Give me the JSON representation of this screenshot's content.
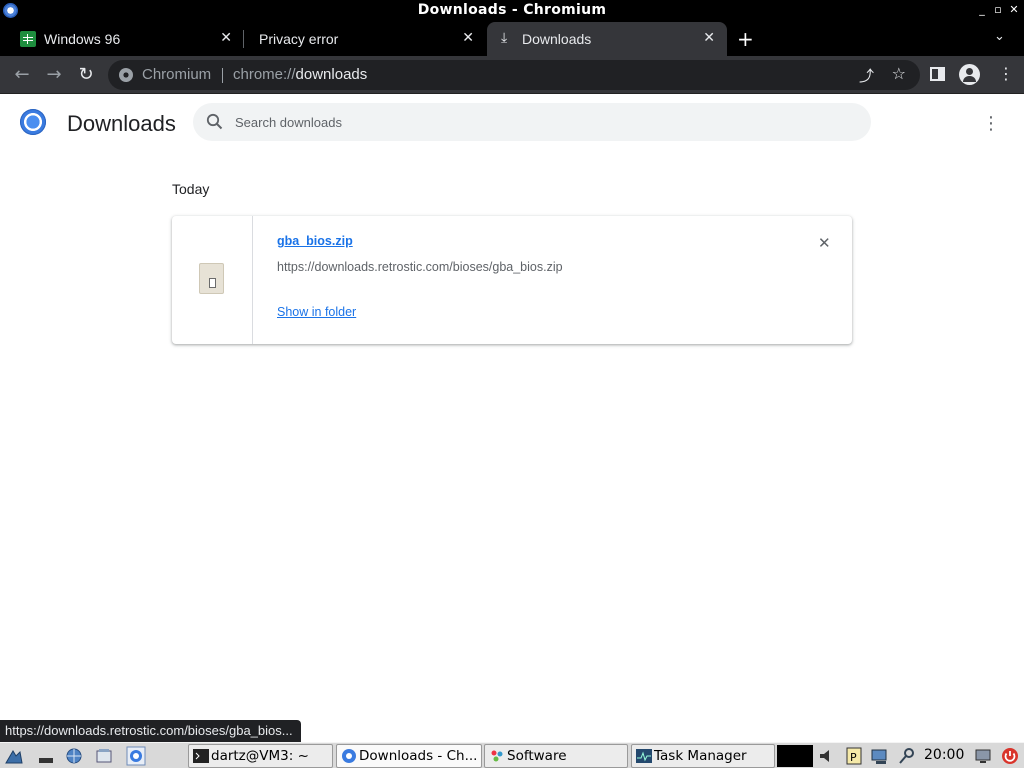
{
  "window": {
    "title": "Downloads - Chromium",
    "minimize_glyph": "_",
    "maximize_glyph": "▫",
    "close_glyph": "✕"
  },
  "tabs": [
    {
      "title": "Windows 96",
      "active": false,
      "favicon": "spreadsheet-icon"
    },
    {
      "title": "Privacy error",
      "active": false,
      "favicon": "none"
    },
    {
      "title": "Downloads",
      "active": true,
      "favicon": "download-icon"
    }
  ],
  "tab_close_glyph": "✕",
  "new_tab_glyph": "+",
  "toolbar": {
    "back_glyph": "←",
    "forward_glyph": "→",
    "reload_glyph": "↻",
    "origin_label": "Chromium",
    "url_scheme": "chrome://",
    "url_host": "downloads",
    "share_glyph": "⤴",
    "star_glyph": "☆",
    "menu_glyph": "⋮"
  },
  "page": {
    "title": "Downloads",
    "search_placeholder": "Search downloads",
    "more_glyph": "⋮",
    "section_label": "Today",
    "downloads": [
      {
        "file_name": "gba_bios.zip",
        "url": "https://downloads.retrostic.com/bioses/gba_bios.zip",
        "action": "Show in folder",
        "remove_glyph": "✕"
      }
    ]
  },
  "status_bubble": "https://downloads.retrostic.com/bioses/gba_bios...",
  "taskbar": {
    "tasks": [
      {
        "label": "dartz@VM3: ~",
        "icon": "terminal-icon",
        "active": false
      },
      {
        "label": "Downloads - Ch...",
        "icon": "chromium-icon",
        "active": true
      },
      {
        "label": "Software",
        "icon": "software-icon",
        "active": false
      },
      {
        "label": "Task Manager",
        "icon": "task-manager-icon",
        "active": false
      }
    ],
    "clock": "20:00"
  },
  "colors": {
    "accent_link": "#1a73e8",
    "toolbar": "#35363a",
    "tabstrip": "#000000",
    "omnibox": "#202124"
  }
}
